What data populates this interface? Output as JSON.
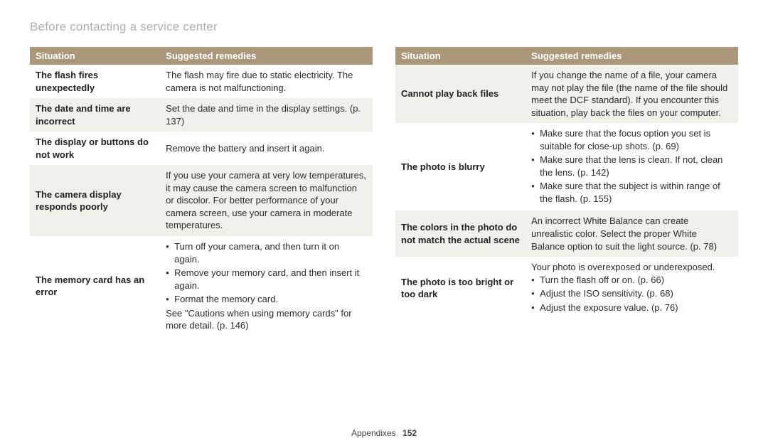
{
  "title": "Before contacting a service center",
  "headers": {
    "situation": "Situation",
    "remedies": "Suggested remedies"
  },
  "left": [
    {
      "situation": "The flash fires unexpectedly",
      "remedy": "The flash may fire due to static electricity. The camera is not malfunctioning."
    },
    {
      "situation": "The date and time are incorrect",
      "remedy": "Set the date and time in the display settings. (p. 137)"
    },
    {
      "situation": "The display or buttons do not work",
      "remedy": "Remove the battery and insert it again."
    },
    {
      "situation": "The camera display responds poorly",
      "remedy": "If you use your camera at very low temperatures, it may cause the camera screen to malfunction or discolor. For better performance of your camera screen, use your camera in moderate temperatures."
    },
    {
      "situation": "The memory card has an error",
      "bullets": [
        "Turn off your camera, and then turn it on again.",
        "Remove your memory card, and then insert it again.",
        "Format the memory card."
      ],
      "tail": "See \"Cautions when using memory cards\" for more detail. (p. 146)"
    }
  ],
  "right": [
    {
      "situation": "Cannot play back files",
      "remedy": "If you change the name of a file, your camera may not play the file (the name of the file should meet the DCF standard). If you encounter this situation, play back the files on your computer."
    },
    {
      "situation": "The photo is blurry",
      "bullets": [
        "Make sure that the focus option you set is suitable for close-up shots. (p. 69)",
        "Make sure that the lens is clean. If not, clean the lens. (p. 142)",
        "Make sure that the subject is within range of the flash. (p. 155)"
      ]
    },
    {
      "situation": "The colors in the photo do not match the actual scene",
      "remedy": "An incorrect White Balance can create unrealistic color. Select the proper White Balance option to suit the light source. (p. 78)"
    },
    {
      "situation": "The photo is too bright or too dark",
      "lead": "Your photo is overexposed or underexposed.",
      "bullets": [
        "Turn the flash off or on. (p. 66)",
        "Adjust the ISO sensitivity. (p. 68)",
        "Adjust the exposure value. (p. 76)"
      ]
    }
  ],
  "footer": {
    "section": "Appendixes",
    "page": "152"
  }
}
